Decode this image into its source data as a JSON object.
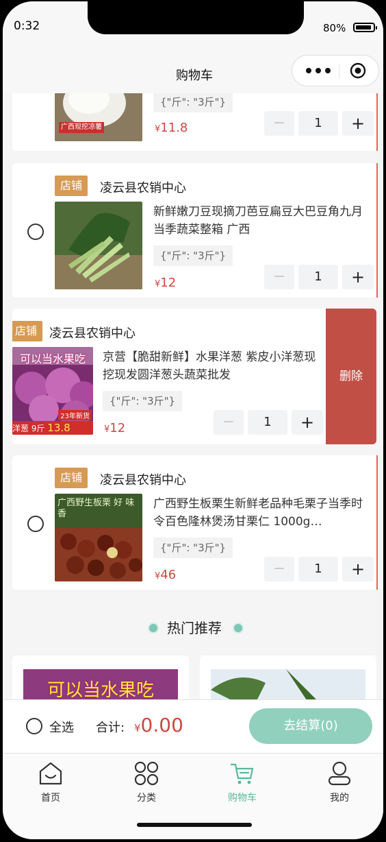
{
  "status_bar": {
    "time": "0:32",
    "battery": "80%"
  },
  "nav": {
    "title": "购物车"
  },
  "cart": {
    "items": [
      {
        "spec": "{\"斤\": \"3斤\"}",
        "price": "11.8",
        "qty": "1",
        "image_text": "广西现挖凉薯"
      },
      {
        "shop_tag": "店铺",
        "shop_name": "凌云县农销中心",
        "title": "新鲜嫩刀豆现摘刀芭豆扁豆大巴豆角九月当季蔬菜整箱 广西",
        "spec": "{\"斤\": \"3斤\"}",
        "price": "12",
        "qty": "1"
      },
      {
        "shop_tag": "店铺",
        "shop_name": "凌云县农销中心",
        "title": "京营【脆甜新鲜】水果洋葱 紫皮小洋葱现挖现发圆洋葱头蔬菜批发",
        "spec": "{\"斤\": \"3斤\"}",
        "price": "12",
        "qty": "1",
        "delete_label": "删除",
        "image_text": "可以当水果吃",
        "image_badge": "23年新货",
        "image_price_label": "洋葱 9斤",
        "image_price": "13.8"
      },
      {
        "shop_tag": "店铺",
        "shop_name": "凌云县农销中心",
        "title": "广西野生板栗生新鲜老品种毛栗子当季时令百色隆林煲汤甘栗仁 1000g…",
        "spec": "{\"斤\": \"3斤\"}",
        "price": "46",
        "qty": "1",
        "image_text": "广西野生板栗 好 味 香"
      }
    ],
    "currency": "¥"
  },
  "recommend": {
    "title": "热门推荐",
    "card1_text": "可以当水果吃"
  },
  "checkout": {
    "select_all": "全选",
    "total_label": "合计:",
    "total_currency": "¥",
    "total_value": "0.00",
    "button": "去结算(0)"
  },
  "tabbar": {
    "tabs": [
      "首页",
      "分类",
      "购物车",
      "我的"
    ],
    "active_color": "#5ab79a"
  },
  "colors": {
    "price": "#c94a40",
    "shop_tag": "#d69a52",
    "delete": "#c24f46",
    "accent": "#91d0bd"
  }
}
